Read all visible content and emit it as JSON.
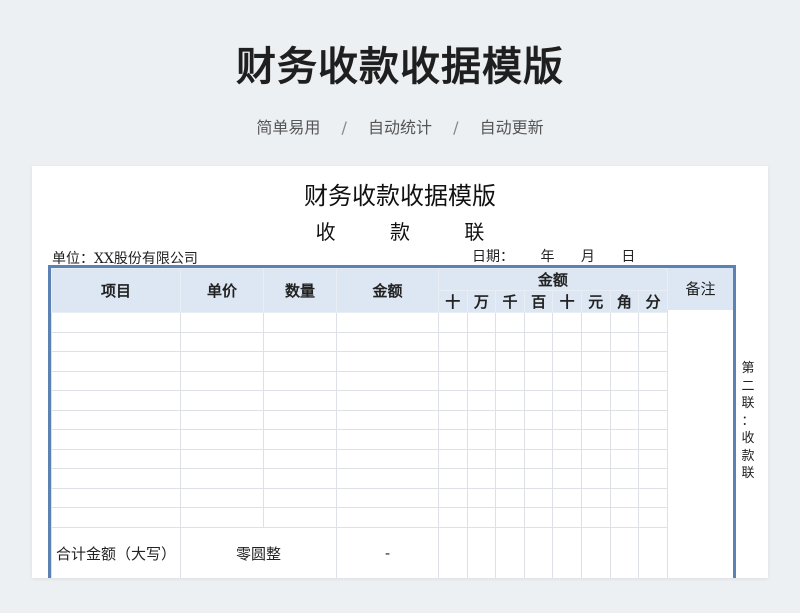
{
  "banner": {
    "title": "财务收款收据模版",
    "tags": [
      "简单易用",
      "自动统计",
      "自动更新"
    ],
    "separator": "/"
  },
  "document": {
    "title": "财务收款收据模版",
    "subtitle": "收 款 联",
    "unit_label": "单位：XX股份有限公司",
    "date_label": "日期：",
    "date_parts": [
      "年",
      "月",
      "日"
    ],
    "side_note": [
      "第",
      "二",
      "联",
      "：",
      "收",
      "款",
      "联"
    ]
  },
  "table": {
    "headers": {
      "item": "项目",
      "unit_price": "单价",
      "quantity": "数量",
      "amount": "金额",
      "amount_group": "金额",
      "remark": "备注"
    },
    "digits": [
      "十",
      "万",
      "千",
      "百",
      "十",
      "元",
      "角",
      "分"
    ],
    "body_rows": 11,
    "total": {
      "label": "合计金额（大写）",
      "value": "零圆整",
      "amount": "-"
    }
  },
  "colors": {
    "frame_border": "#5b81b5",
    "header_fill": "#dde7f3",
    "page_background": "#edf0f3"
  }
}
